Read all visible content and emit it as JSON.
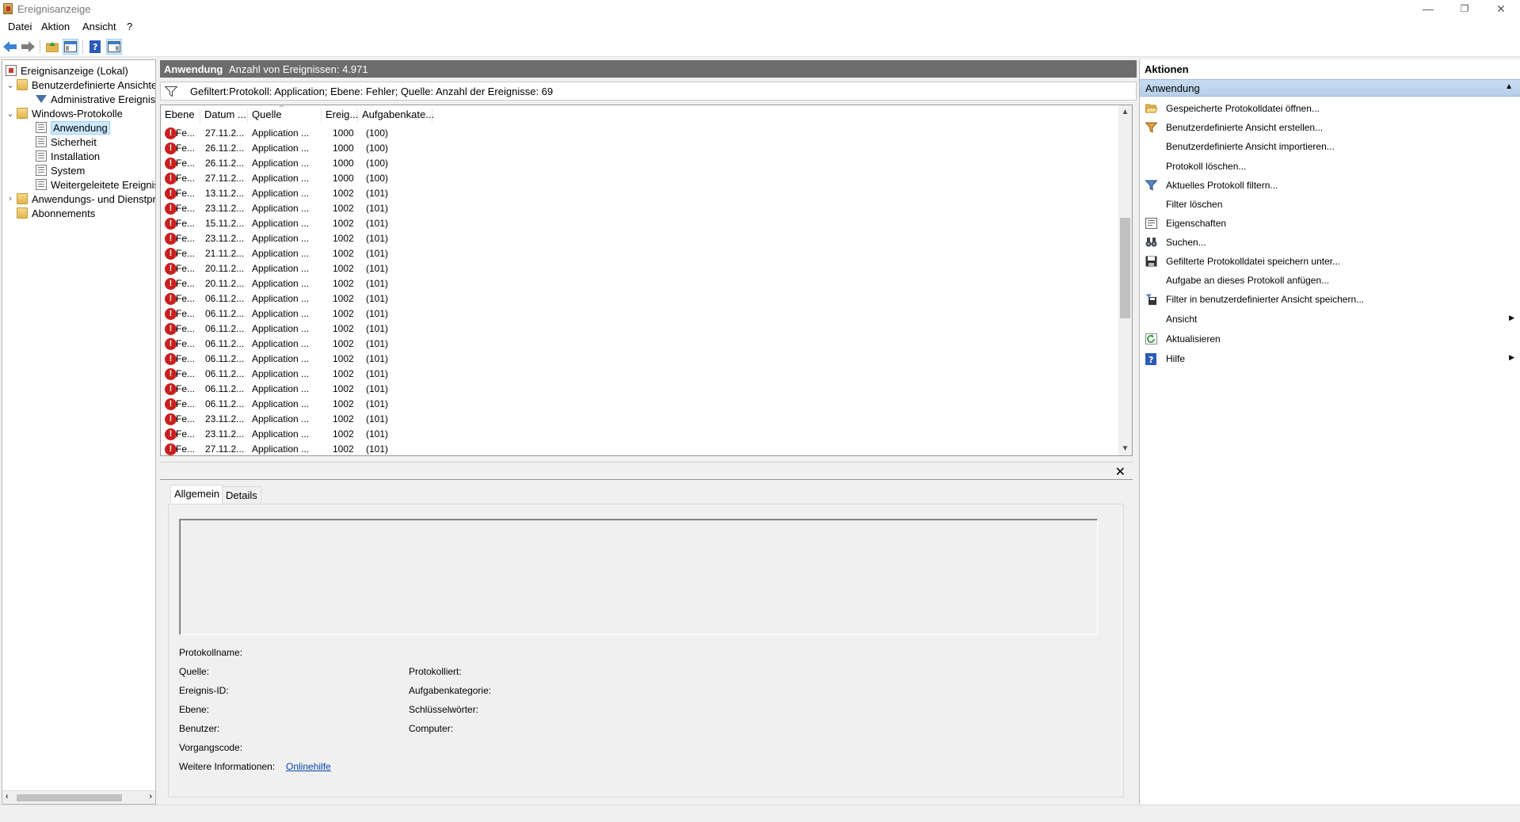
{
  "window": {
    "title": "Ereignisanzeige",
    "minimize": "—",
    "restore": "❐",
    "close": "✕"
  },
  "menu": [
    "Datei",
    "Aktion",
    "Ansicht",
    "?"
  ],
  "tree": {
    "root": "Ereignisanzeige (Lokal)",
    "custom_views": "Benutzerdefinierte Ansichten",
    "admin_events": "Administrative Ereignisse",
    "windows_logs": "Windows-Protokolle",
    "logs": [
      "Anwendung",
      "Sicherheit",
      "Installation",
      "System",
      "Weitergeleitete Ereignisse"
    ],
    "app_services": "Anwendungs- und Dienstprotokolle",
    "subscriptions": "Abonnements"
  },
  "center": {
    "log_name": "Anwendung",
    "count_label": "Anzahl von Ereignissen: 4.971",
    "filter_text": "Gefiltert:Protokoll: Application; Ebene: Fehler; Quelle:  Anzahl der Ereignisse: 69"
  },
  "columns": [
    "Ebene",
    "Datum ...",
    "Quelle",
    "Ereig...",
    "Aufgabenkate..."
  ],
  "events": [
    [
      "Fe...",
      "27.11.2...",
      "Application ...",
      "1000",
      "(100)"
    ],
    [
      "Fe...",
      "26.11.2...",
      "Application ...",
      "1000",
      "(100)"
    ],
    [
      "Fe...",
      "26.11.2...",
      "Application ...",
      "1000",
      "(100)"
    ],
    [
      "Fe...",
      "27.11.2...",
      "Application ...",
      "1000",
      "(100)"
    ],
    [
      "Fe...",
      "13.11.2...",
      "Application ...",
      "1002",
      "(101)"
    ],
    [
      "Fe...",
      "23.11.2...",
      "Application ...",
      "1002",
      "(101)"
    ],
    [
      "Fe...",
      "15.11.2...",
      "Application ...",
      "1002",
      "(101)"
    ],
    [
      "Fe...",
      "23.11.2...",
      "Application ...",
      "1002",
      "(101)"
    ],
    [
      "Fe...",
      "21.11.2...",
      "Application ...",
      "1002",
      "(101)"
    ],
    [
      "Fe...",
      "20.11.2...",
      "Application ...",
      "1002",
      "(101)"
    ],
    [
      "Fe...",
      "20.11.2...",
      "Application ...",
      "1002",
      "(101)"
    ],
    [
      "Fe...",
      "06.11.2...",
      "Application ...",
      "1002",
      "(101)"
    ],
    [
      "Fe...",
      "06.11.2...",
      "Application ...",
      "1002",
      "(101)"
    ],
    [
      "Fe...",
      "06.11.2...",
      "Application ...",
      "1002",
      "(101)"
    ],
    [
      "Fe...",
      "06.11.2...",
      "Application ...",
      "1002",
      "(101)"
    ],
    [
      "Fe...",
      "06.11.2...",
      "Application ...",
      "1002",
      "(101)"
    ],
    [
      "Fe...",
      "06.11.2...",
      "Application ...",
      "1002",
      "(101)"
    ],
    [
      "Fe...",
      "06.11.2...",
      "Application ...",
      "1002",
      "(101)"
    ],
    [
      "Fe...",
      "06.11.2...",
      "Application ...",
      "1002",
      "(101)"
    ],
    [
      "Fe...",
      "23.11.2...",
      "Application ...",
      "1002",
      "(101)"
    ],
    [
      "Fe...",
      "23.11.2...",
      "Application ...",
      "1002",
      "(101)"
    ],
    [
      "Fe...",
      "27.11.2...",
      "Application ...",
      "1002",
      "(101)"
    ]
  ],
  "details": {
    "tabs": [
      "Allgemein",
      "Details"
    ],
    "close": "✕",
    "fields": {
      "log_name": "Protokollname:",
      "source": "Quelle:",
      "logged": "Protokolliert:",
      "event_id": "Ereignis-ID:",
      "task_category": "Aufgabenkategorie:",
      "level": "Ebene:",
      "keywords": "Schlüsselwörter:",
      "user": "Benutzer:",
      "computer": "Computer:",
      "opcode": "Vorgangscode:",
      "more_info": "Weitere Informationen:",
      "online_help": "Onlinehilfe"
    }
  },
  "actions": {
    "header": "Aktionen",
    "section": "Anwendung",
    "items": [
      {
        "label": "Gespeicherte Protokolldatei öffnen...",
        "icon": "folder-open-icon"
      },
      {
        "label": "Benutzerdefinierte Ansicht erstellen...",
        "icon": "filter-create-icon"
      },
      {
        "label": "Benutzerdefinierte Ansicht importieren...",
        "icon": ""
      },
      {
        "label": "Protokoll löschen...",
        "icon": ""
      },
      {
        "label": "Aktuelles Protokoll filtern...",
        "icon": "filter-icon"
      },
      {
        "label": "Filter löschen",
        "icon": ""
      },
      {
        "label": "Eigenschaften",
        "icon": "properties-icon"
      },
      {
        "label": "Suchen...",
        "icon": "binoculars-icon"
      },
      {
        "label": "Gefilterte Protokolldatei speichern unter...",
        "icon": "save-icon"
      },
      {
        "label": "Aufgabe an dieses Protokoll anfügen...",
        "icon": ""
      },
      {
        "label": "Filter in benutzerdefinierter Ansicht speichern...",
        "icon": "save-filter-icon"
      },
      {
        "label": "Ansicht",
        "icon": "",
        "submenu": true
      },
      {
        "label": "Aktualisieren",
        "icon": "refresh-icon"
      },
      {
        "label": "Hilfe",
        "icon": "help-icon",
        "submenu": true
      }
    ]
  },
  "colors": {
    "header_bg": "#6d6d6d",
    "section_bg": "#c7dcf2",
    "error_red": "#c8201f",
    "link": "#0645ad"
  }
}
